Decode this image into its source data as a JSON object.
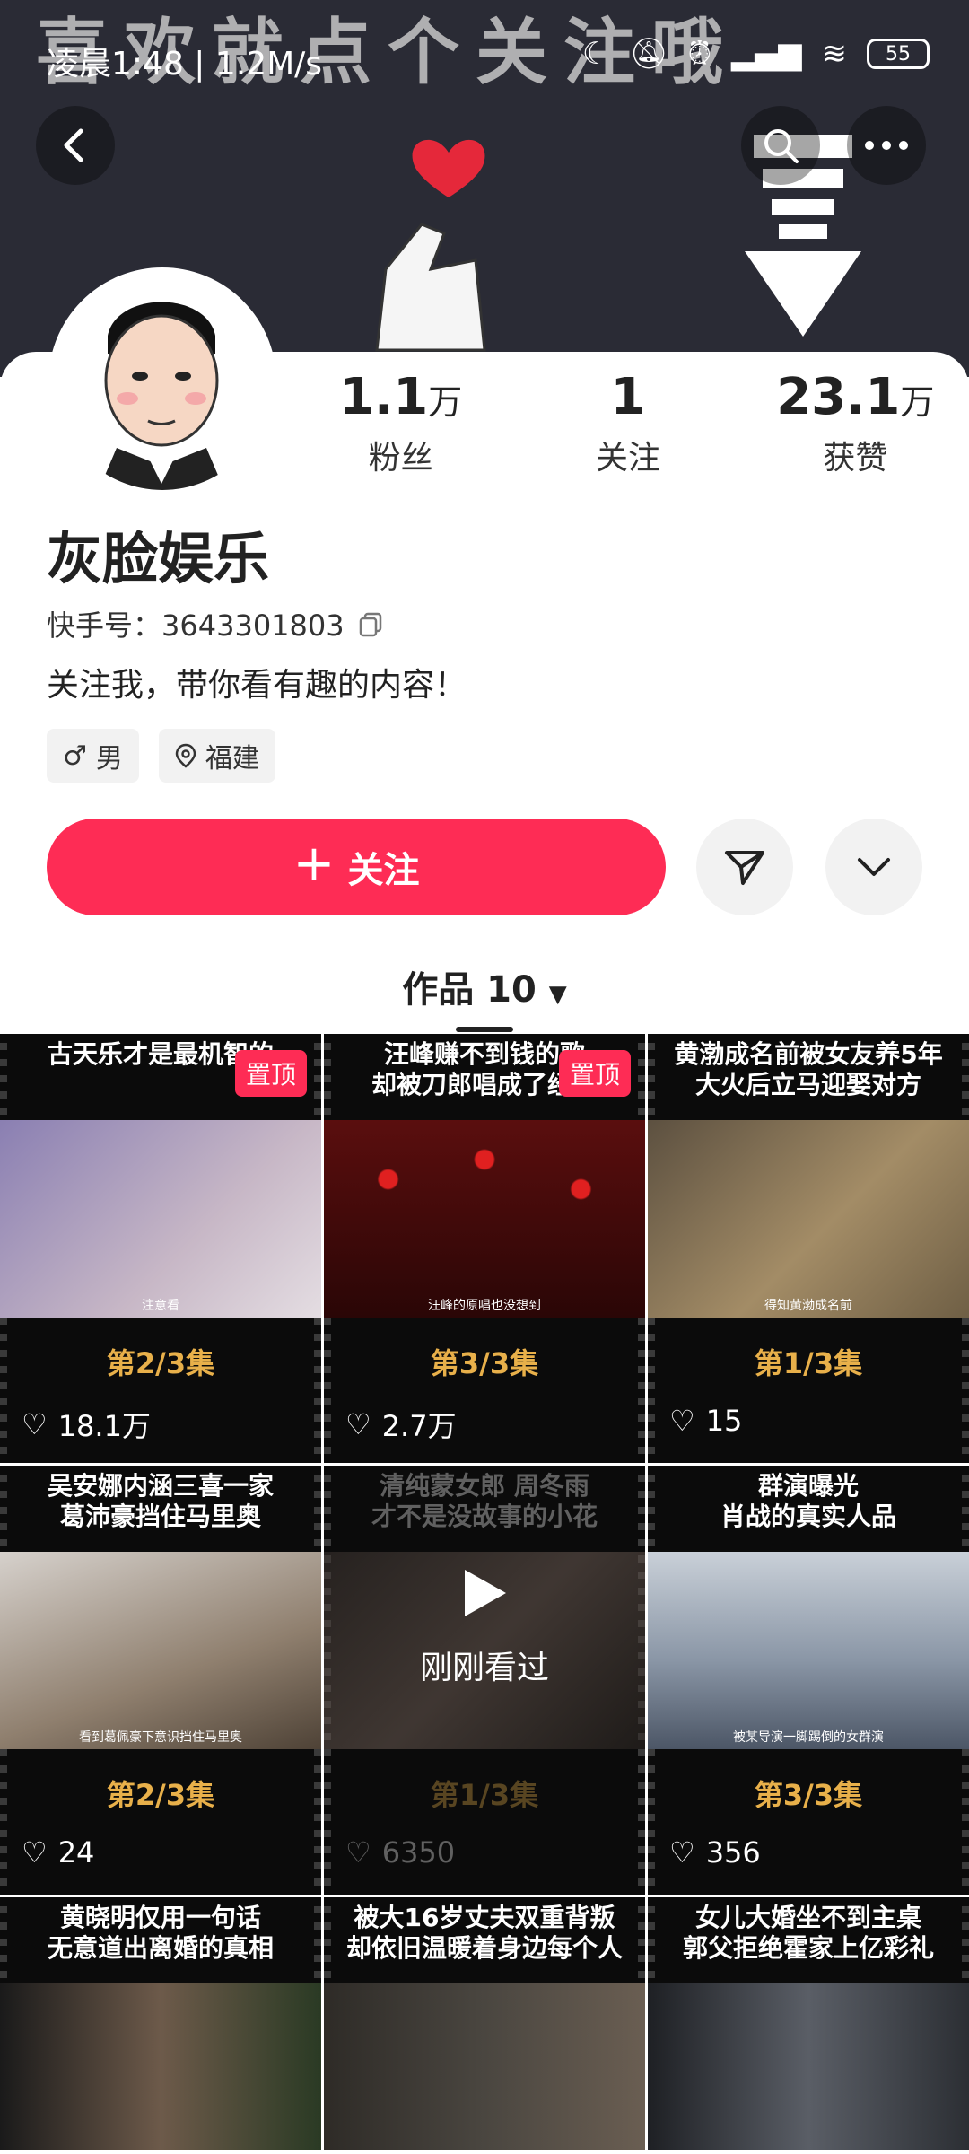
{
  "status_bar": {
    "time": "凌晨1:48 | 1.2M/s",
    "battery": "55"
  },
  "banner": {
    "text": "喜欢就点个关注哦"
  },
  "profile": {
    "name": "灰脸娱乐",
    "kuaishou_id_label": "快手号：",
    "kuaishou_id": "3643301803",
    "bio": "关注我，带你看有趣的内容！",
    "gender": "男",
    "location": "福建",
    "stats": [
      {
        "num": "1.1",
        "unit": "万",
        "label": "粉丝"
      },
      {
        "num": "1",
        "unit": "",
        "label": "关注"
      },
      {
        "num": "23.1",
        "unit": "万",
        "label": "获赞"
      }
    ]
  },
  "actions": {
    "follow_label": "关注"
  },
  "works": {
    "label": "作品 10"
  },
  "videos": [
    {
      "caption": "古天乐才是最机智的",
      "sub": "注意看",
      "episode": "第2/3集",
      "likes": "18.1万",
      "pinned": "置顶",
      "tone": "#b79fb6"
    },
    {
      "caption": "汪峰赚不到钱的歌\n却被刀郎唱成了经典",
      "sub": "汪峰的原唱也没想到",
      "episode": "第3/3集",
      "likes": "2.7万",
      "pinned": "置顶",
      "tone": "#7a1a1a"
    },
    {
      "caption": "黄渤成名前被女友养5年\n大火后立马迎娶对方",
      "sub": "得知黄渤成名前",
      "episode": "第1/3集",
      "likes": "15",
      "pinned": "",
      "tone": "#8c7a55"
    },
    {
      "caption": "吴安娜内涵三喜一家\n葛沛豪挡住马里奥",
      "sub": "看到葛佩豪下意识挡住马里奥",
      "episode": "第2/3集",
      "likes": "24",
      "pinned": "",
      "tone": "#c7b39c"
    },
    {
      "caption": "清纯蒙女郎 周冬雨\n才不是没故事的小花",
      "sub": "",
      "episode": "第1/3集",
      "likes": "6350",
      "pinned": "",
      "tone": "#6a5a52",
      "watched": "刚刚看过"
    },
    {
      "caption": "群演曝光\n肖战的真实人品",
      "sub": "被某导演一脚踢倒的女群演",
      "episode": "第3/3集",
      "likes": "356",
      "pinned": "",
      "tone": "#8a96a6"
    },
    {
      "caption": "黄晓明仅用一句话\n无意道出离婚的真相",
      "sub": "",
      "episode": "",
      "likes": "",
      "pinned": "",
      "tone": "#6d5a4a"
    },
    {
      "caption": "被大16岁丈夫双重背叛\n却依旧温暖着身边每个人",
      "sub": "",
      "episode": "",
      "likes": "",
      "pinned": "",
      "tone": "#4a4640"
    },
    {
      "caption": "女儿大婚坐不到主桌\n郭父拒绝霍家上亿彩礼",
      "sub": "",
      "episode": "",
      "likes": "",
      "pinned": "",
      "tone": "#5a5e66"
    }
  ]
}
